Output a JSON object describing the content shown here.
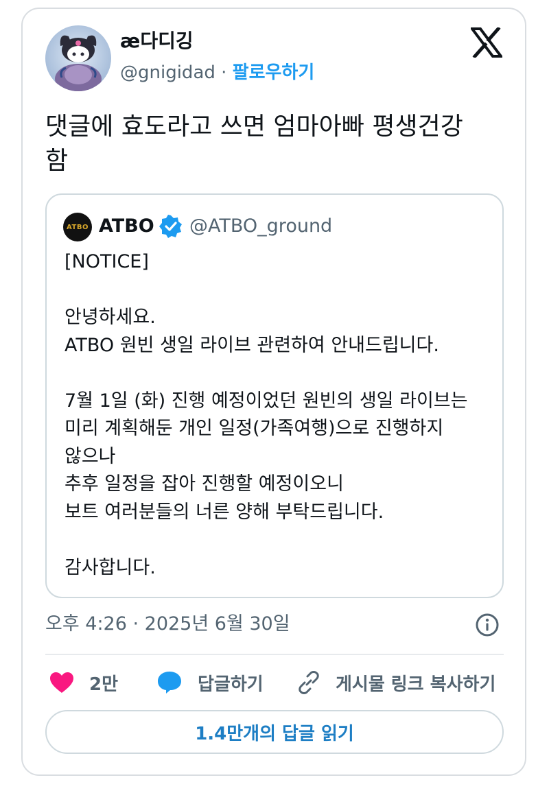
{
  "author": {
    "display_name": "æ다디깅",
    "handle": "@gnigidad",
    "separator": "·",
    "follow_label": "팔로우하기"
  },
  "tweet": {
    "text_lines": [
      "댓글에 효도라고 쓰면 엄마아빠 평생건강",
      "함"
    ]
  },
  "quoted": {
    "avatar_text": "ATBO",
    "name": "ATBO",
    "handle": "@ATBO_ground",
    "body_lines": [
      "[NOTICE]",
      "",
      "안녕하세요.",
      "ATBO 원빈 생일 라이브 관련하여 안내드립니다.",
      "",
      "7월 1일 (화) 진행 예정이었던 원빈의 생일 라이브는",
      "미리 계획해둔 개인 일정(가족여행)으로 진행하지",
      "않으나",
      "추후 일정을 잡아 진행할 예정이오니",
      "보트 여러분들의 너른 양해 부탁드립니다.",
      "",
      "감사합니다."
    ]
  },
  "meta": {
    "timestamp": "오후 4:26 · 2025년 6월 30일"
  },
  "actions": {
    "like_count": "2만",
    "reply_label": "답글하기",
    "copy_link_label": "게시물 링크 복사하기"
  },
  "read_replies_label": "1.4만개의 답글 읽기",
  "colors": {
    "accent": "#1d9bf0",
    "like": "#f91880",
    "muted_text": "#536471",
    "border": "#cfd9de"
  },
  "icons": {
    "logo": "x-logo-icon",
    "verified": "verified-badge-icon",
    "info": "info-icon",
    "like": "heart-icon",
    "reply": "speech-bubble-icon",
    "copy": "link-icon"
  }
}
